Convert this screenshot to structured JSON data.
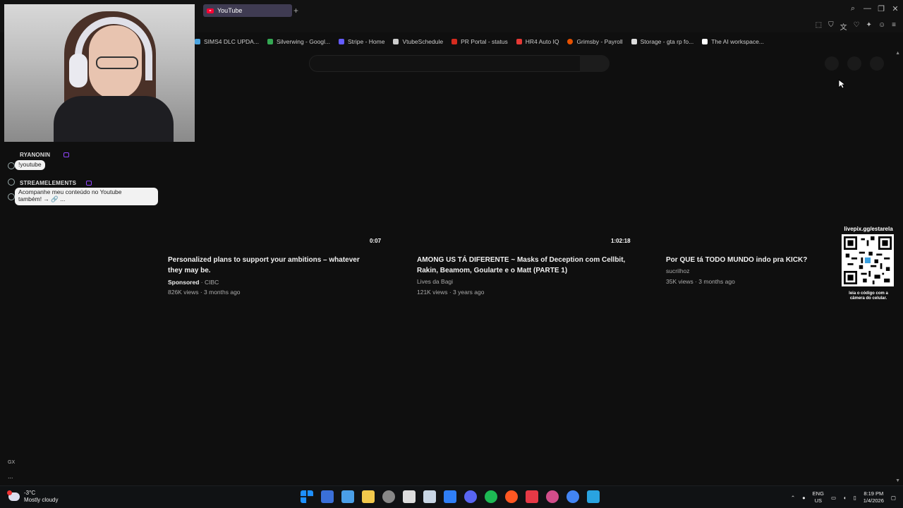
{
  "browser": {
    "tab_title": "YouTube",
    "new_tab": "+",
    "bookmarks": [
      {
        "label": "SIMS4 DLC UPDA...",
        "color": "#4aa3df"
      },
      {
        "label": "Silverwing - Googl...",
        "color": "#34a853"
      },
      {
        "label": "Stripe - Home",
        "color": "#635bff"
      },
      {
        "label": "VtubeSchedule",
        "color": "#cccccc"
      },
      {
        "label": "PR Portal - status",
        "color": "#d52b1e"
      },
      {
        "label": "HR4 Auto IQ",
        "color": "#e53935"
      },
      {
        "label": "Grimsby - Payroll",
        "color": "#e65100"
      },
      {
        "label": "Storage - gta rp fo...",
        "color": "#dddddd"
      },
      {
        "label": "The AI workspace...",
        "color": "#ffffff"
      }
    ]
  },
  "chat": [
    {
      "user": "RYANONIN",
      "message": "!youtube"
    },
    {
      "user": "STREAMELEMENTS",
      "message_line1": "Acompanhe meu conteúdo no Youtube",
      "message_line2": "também! → 🔗 ..."
    }
  ],
  "videos": [
    {
      "duration": "0:07",
      "title_line1": "Personalized plans to support your ambitions – whatever",
      "title_line2": "they may be.",
      "sponsored": "Sponsored",
      "channel": "· CIBC",
      "stats": "826K views · 3 months ago"
    },
    {
      "duration": "1:02:18",
      "title_line1": "AMONG US TÁ DIFERENTE ~ Masks of Deception com Cellbit,",
      "title_line2": "Rakin, Beamom, Goularte e o Matt (PARTE 1)",
      "channel": "Lives da Bagi",
      "stats": "121K views · 3 years ago"
    },
    {
      "title_line1": "Por QUE tá TODO MUNDO indo pra KICK?",
      "channel": "sucrilhoz",
      "stats": "35K views · 3 months ago"
    }
  ],
  "qr": {
    "label": "livepix.gg/estarela",
    "caption_line1": "leia o código com a",
    "caption_line2": "câmera do celular."
  },
  "sidebar": {
    "gx": "GX",
    "more": "..."
  },
  "taskbar": {
    "temp": "-3°C",
    "weather": "Mostly cloudy",
    "lang_line1": "ENG",
    "lang_line2": "US",
    "time": "8:19 PM",
    "date": "1/4/2026",
    "apps": [
      "#1e90ff",
      "#3a6fd8",
      "#4a9fe8",
      "#f2c94c",
      "#888888",
      "#dddddd",
      "#c8d6e5",
      "#2f7ff7",
      "#5865f2",
      "#1db954",
      "#ff5722",
      "#e63946",
      "#d24d8a",
      "#4285f4",
      "#29a3e0"
    ]
  }
}
